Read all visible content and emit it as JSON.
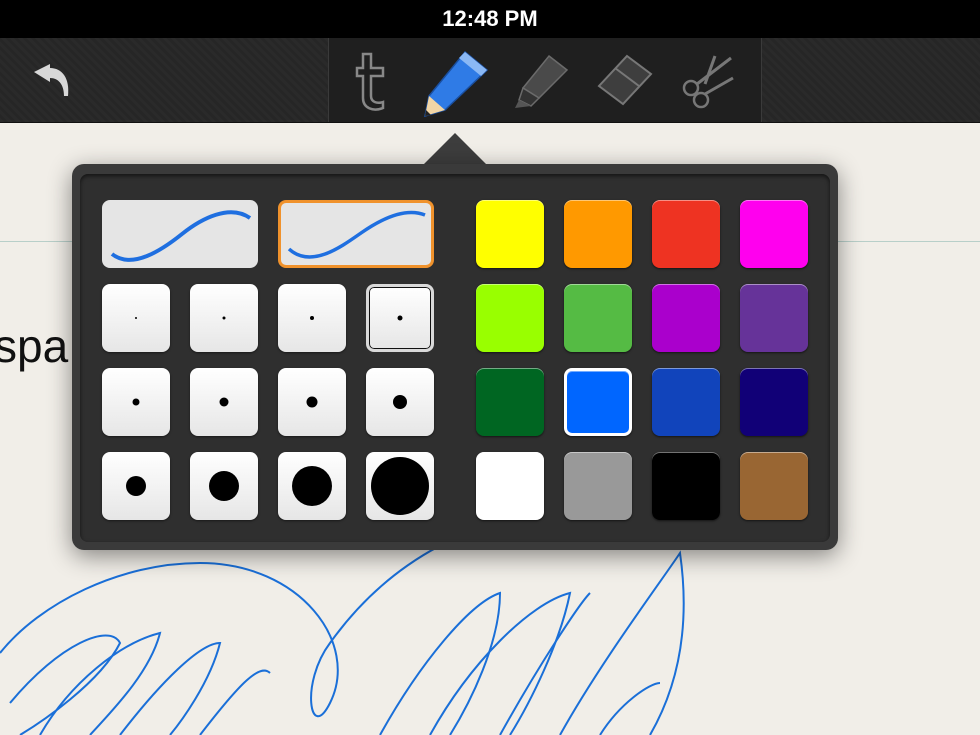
{
  "status_bar": {
    "time": "12:48 PM"
  },
  "toolbar": {
    "undo_icon": "undo-arrow-icon",
    "tools": [
      {
        "name": "text",
        "icon": "text-t-icon"
      },
      {
        "name": "pencil",
        "icon": "pencil-icon",
        "selected": true
      },
      {
        "name": "highlighter",
        "icon": "highlighter-icon"
      },
      {
        "name": "eraser",
        "icon": "eraser-icon"
      },
      {
        "name": "scissors",
        "icon": "scissors-icon"
      }
    ]
  },
  "document": {
    "visible_text": "spa",
    "ink_color": "#1a6fd8"
  },
  "popover": {
    "stroke_styles": [
      {
        "style": "smooth-curve",
        "selected": false
      },
      {
        "style": "tapered-curve",
        "selected": true
      }
    ],
    "selected_size_index": 3,
    "selected_color_index": 9,
    "colors": [
      "#ffff00",
      "#ff9900",
      "#ee3322",
      "#ff00ee",
      "#99ff00",
      "#55bb44",
      "#aa00cc",
      "#663399",
      "#006622",
      "#0066ff",
      "#1144bb",
      "#110077",
      "#ffffff",
      "#999999",
      "#000000",
      "#996633"
    ],
    "selected_border_color": "#f0922c"
  }
}
